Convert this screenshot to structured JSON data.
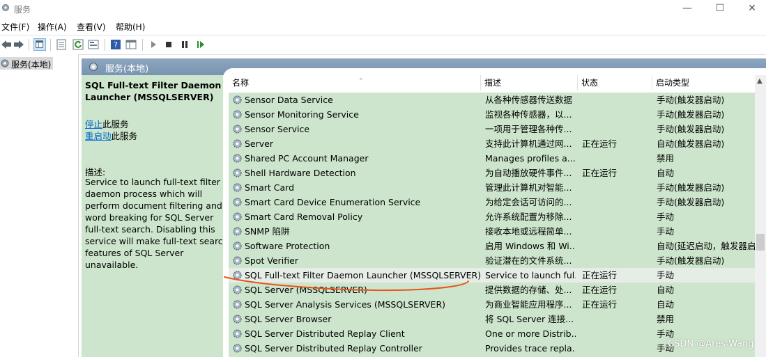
{
  "window": {
    "title": "服务",
    "min_icon": "minimize-icon",
    "max_icon": "maximize-icon",
    "close_icon": "close-icon"
  },
  "menu": [
    "文件(F)",
    "操作(A)",
    "查看(V)",
    "帮助(H)"
  ],
  "toolbar_icons": [
    "back-arrow-icon",
    "forward-arrow-icon",
    "console-tree-icon",
    "properties-icon",
    "refresh-icon",
    "export-list-icon",
    "help-icon",
    "mmc-view-icon",
    "start-service-icon",
    "stop-service-icon",
    "pause-service-icon",
    "resume-service-icon"
  ],
  "tree": {
    "item": "服务(本地)"
  },
  "main": {
    "header": "服务(本地)",
    "selected_title": "SQL Full-text Filter Daemon Launcher (MSSQLSERVER)",
    "stop_link": "停止",
    "stop_suffix": "此服务",
    "restart_link": "重启动",
    "restart_suffix": "此服务",
    "desc_label": "描述:",
    "desc_text": "Service to launch full-text filter daemon process which will perform document filtering and word breaking for SQL Server full-text search. Disabling this service will make full-text search features of SQL Server unavailable."
  },
  "columns": {
    "name": "名称",
    "desc": "描述",
    "status": "状态",
    "startup": "启动类型"
  },
  "rows": [
    {
      "name": "Sensor Data Service",
      "desc": "从各种传感器传送数据",
      "status": "",
      "startup": "手动(触发器启动)"
    },
    {
      "name": "Sensor Monitoring Service",
      "desc": "监视各种传感器，以...",
      "status": "",
      "startup": "手动(触发器启动)"
    },
    {
      "name": "Sensor Service",
      "desc": "一项用于管理各种传...",
      "status": "",
      "startup": "手动(触发器启动)"
    },
    {
      "name": "Server",
      "desc": "支持此计算机通过网...",
      "status": "正在运行",
      "startup": "自动(触发器启动)"
    },
    {
      "name": "Shared PC Account Manager",
      "desc": "Manages profiles a...",
      "status": "",
      "startup": "禁用"
    },
    {
      "name": "Shell Hardware Detection",
      "desc": "为自动播放硬件事件...",
      "status": "正在运行",
      "startup": "自动"
    },
    {
      "name": "Smart Card",
      "desc": "管理此计算机对智能...",
      "status": "",
      "startup": "手动(触发器启动)"
    },
    {
      "name": "Smart Card Device Enumeration Service",
      "desc": "为给定会话可访问的...",
      "status": "",
      "startup": "手动(触发器启动)"
    },
    {
      "name": "Smart Card Removal Policy",
      "desc": "允许系统配置为移除...",
      "status": "",
      "startup": "手动"
    },
    {
      "name": "SNMP 陷阱",
      "desc": "接收本地或远程简单...",
      "status": "",
      "startup": "手动"
    },
    {
      "name": "Software Protection",
      "desc": "启用 Windows 和 Wi...",
      "status": "",
      "startup": "自动(延迟启动，触发器启动)"
    },
    {
      "name": "Spot Verifier",
      "desc": "验证潜在的文件系统...",
      "status": "",
      "startup": "手动(触发器启动)"
    },
    {
      "name": "SQL Full-text Filter Daemon Launcher (MSSQLSERVER)",
      "desc": "Service to launch ful...",
      "status": "正在运行",
      "startup": "手动"
    },
    {
      "name": "SQL Server (MSSQLSERVER)",
      "desc": "提供数据的存储、处...",
      "status": "正在运行",
      "startup": "自动"
    },
    {
      "name": "SQL Server Analysis Services (MSSQLSERVER)",
      "desc": "为商业智能应用程序...",
      "status": "正在运行",
      "startup": "自动"
    },
    {
      "name": "SQL Server Browser",
      "desc": "将 SQL Server 连接...",
      "status": "",
      "startup": "禁用"
    },
    {
      "name": "SQL Server Distributed Replay Client",
      "desc": "One or more Distrib...",
      "status": "",
      "startup": "手动"
    },
    {
      "name": "SQL Server Distributed Replay Controller",
      "desc": "Provides trace repla...",
      "status": "",
      "startup": "手动"
    }
  ],
  "selected_row": 12,
  "watermark": "CSDN @Ares-Wang",
  "colors": {
    "panel_bg": "#cce5cc",
    "annotation": "#e8541c",
    "link": "#0066cc"
  }
}
